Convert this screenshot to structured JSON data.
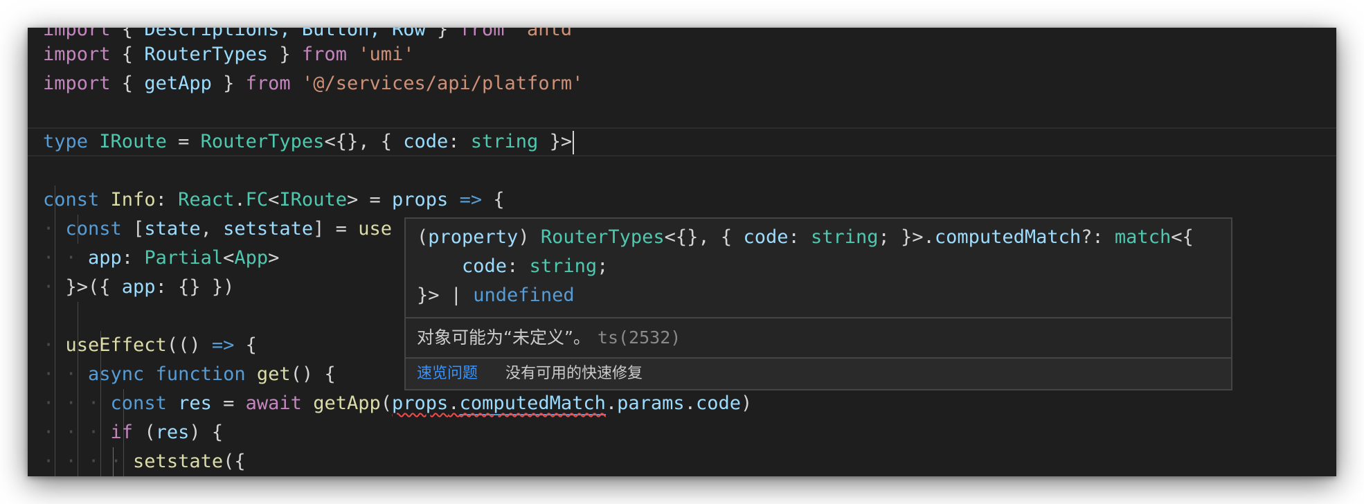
{
  "editor": {
    "lines": {
      "l0": {
        "kw_import": "import",
        "brace_open": " { ",
        "names": "Descriptions, Button, Row",
        "brace_close": " } ",
        "kw_from": "from",
        "sp": " ",
        "module": "'antd'"
      },
      "l1": {
        "kw_import": "import",
        "brace_open": " { ",
        "name": "RouterTypes",
        "brace_close": " } ",
        "kw_from": "from",
        "sp": " ",
        "module": "'umi'"
      },
      "l2": {
        "kw_import": "import",
        "brace_open": " { ",
        "name": "getApp",
        "brace_close": " } ",
        "kw_from": "from",
        "sp": " ",
        "module": "'@/services/api/platform'"
      },
      "l4": {
        "kw_type": "type",
        "sp1": " ",
        "name": "IRoute",
        "eq": " = ",
        "router": "RouterTypes",
        "p1": "<{}, { ",
        "code": "code",
        "colon": ": ",
        "string": "string",
        "p2": " }>"
      },
      "l6": {
        "kw_const": "const",
        "sp1": " ",
        "name": "Info",
        "colon": ": ",
        "react": "React",
        "dot": ".",
        "fc": "FC",
        "lt": "<",
        "iroute": "IRoute",
        "gt": ">",
        "eq": " = ",
        "props": "props",
        "sp2": " ",
        "arrow": "=>",
        "brace": " {"
      },
      "l7": {
        "indent": "· ",
        "kw_const": "const",
        "rest": " [",
        "state": "state",
        "comma": ", ",
        "setstate": "setstate",
        "close": "] = ",
        "use": "use"
      },
      "l8": {
        "indent": "· · ",
        "app": "app",
        "colon": ": ",
        "partial": "Partial",
        "lt": "<",
        "apptype": "App",
        "gt": ">"
      },
      "l9": {
        "indent": "· ",
        "p1": "}>({ ",
        "app": "app",
        "p2": ": {} })"
      },
      "l11": {
        "indent": "· ",
        "fn": "useEffect",
        "p1": "(() ",
        "arrow": "=>",
        "p2": " {"
      },
      "l12": {
        "indent": "· · ",
        "kw_async": "async",
        "sp1": " ",
        "kw_function": "function",
        "sp2": " ",
        "fn": "get",
        "p1": "() {"
      },
      "l13": {
        "indent": "· · · ",
        "kw_const": "const",
        "sp1": " ",
        "res": "res",
        "eq": " = ",
        "kw_await": "await",
        "sp2": " ",
        "fn": "getApp",
        "p1": "(",
        "props": "props",
        "dot1": ".",
        "computed": "computedMatch",
        "dot2": ".",
        "params": "params",
        "dot3": ".",
        "code": "code",
        "p2": ")"
      },
      "l14": {
        "indent": "· · · ",
        "kw_if": "if",
        "p1": " (",
        "res": "res",
        "p2": ") {"
      },
      "l15": {
        "indent": "· · · · ",
        "fn": "setstate",
        "p1": "({"
      }
    }
  },
  "hover": {
    "sig1": {
      "p1": "(",
      "property": "property",
      "p2": ") ",
      "router": "RouterTypes",
      "p3": "<{}, { ",
      "code": "code",
      "colon": ": ",
      "string": "string",
      "p4": "; }>.",
      "computed": "computedMatch",
      "p5": "?: ",
      "match": "match",
      "p6": "<{"
    },
    "sig2": {
      "indent": "    ",
      "code": "code",
      "colon": ": ",
      "string": "string",
      "semi": ";"
    },
    "sig3": {
      "p1": "}> | ",
      "undef": "undefined"
    },
    "message": "对象可能为“未定义”。",
    "error_code": "ts(2532)",
    "peek_problem": "速览问题",
    "no_quick_fix": "没有可用的快速修复"
  }
}
